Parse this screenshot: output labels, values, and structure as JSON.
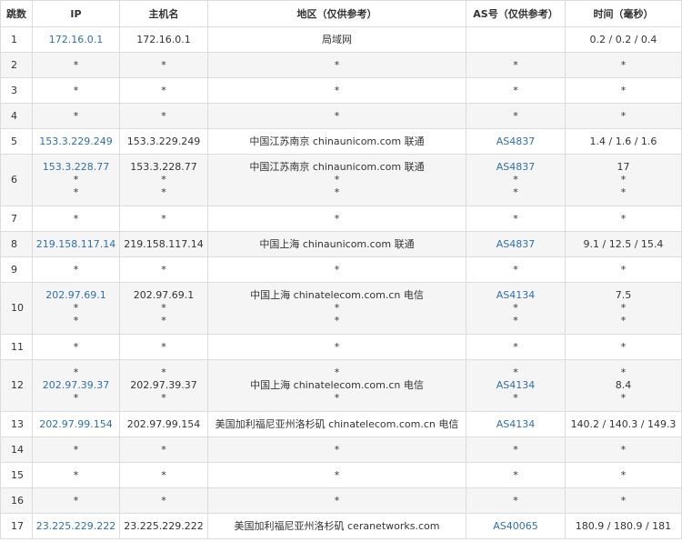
{
  "headers": {
    "hop": "跳数",
    "ip": "IP",
    "host": "主机名",
    "region": "地区（仅供参考）",
    "as": "AS号（仅供参考）",
    "time": "时间（毫秒）"
  },
  "rows": [
    {
      "hop": "1",
      "ip": [
        "172.16.0.1"
      ],
      "host": [
        "172.16.0.1"
      ],
      "region": [
        "局域网"
      ],
      "as": [
        ""
      ],
      "time": [
        "0.2 / 0.2 / 0.4"
      ]
    },
    {
      "hop": "2",
      "ip": [
        "*"
      ],
      "host": [
        "*"
      ],
      "region": [
        "*"
      ],
      "as": [
        "*"
      ],
      "time": [
        "*"
      ]
    },
    {
      "hop": "3",
      "ip": [
        "*"
      ],
      "host": [
        "*"
      ],
      "region": [
        "*"
      ],
      "as": [
        "*"
      ],
      "time": [
        "*"
      ]
    },
    {
      "hop": "4",
      "ip": [
        "*"
      ],
      "host": [
        "*"
      ],
      "region": [
        "*"
      ],
      "as": [
        "*"
      ],
      "time": [
        "*"
      ]
    },
    {
      "hop": "5",
      "ip": [
        "153.3.229.249"
      ],
      "host": [
        "153.3.229.249"
      ],
      "region": [
        "中国江苏南京 chinaunicom.com 联通"
      ],
      "as": [
        "AS4837"
      ],
      "time": [
        "1.4 / 1.6 / 1.6"
      ]
    },
    {
      "hop": "6",
      "ip": [
        "153.3.228.77",
        "*",
        "*"
      ],
      "host": [
        "153.3.228.77",
        "*",
        "*"
      ],
      "region": [
        "中国江苏南京 chinaunicom.com 联通",
        "*",
        "*"
      ],
      "as": [
        "AS4837",
        "*",
        "*"
      ],
      "time": [
        "17",
        "*",
        "*"
      ]
    },
    {
      "hop": "7",
      "ip": [
        "*"
      ],
      "host": [
        "*"
      ],
      "region": [
        "*"
      ],
      "as": [
        "*"
      ],
      "time": [
        "*"
      ]
    },
    {
      "hop": "8",
      "ip": [
        "219.158.117.14"
      ],
      "host": [
        "219.158.117.14"
      ],
      "region": [
        "中国上海 chinaunicom.com 联通"
      ],
      "as": [
        "AS4837"
      ],
      "time": [
        "9.1 / 12.5 / 15.4"
      ]
    },
    {
      "hop": "9",
      "ip": [
        "*"
      ],
      "host": [
        "*"
      ],
      "region": [
        "*"
      ],
      "as": [
        "*"
      ],
      "time": [
        "*"
      ]
    },
    {
      "hop": "10",
      "ip": [
        "202.97.69.1",
        "*",
        "*"
      ],
      "host": [
        "202.97.69.1",
        "*",
        "*"
      ],
      "region": [
        "中国上海 chinatelecom.com.cn 电信",
        "*",
        "*"
      ],
      "as": [
        "AS4134",
        "*",
        "*"
      ],
      "time": [
        "7.5",
        "*",
        "*"
      ]
    },
    {
      "hop": "11",
      "ip": [
        "*"
      ],
      "host": [
        "*"
      ],
      "region": [
        "*"
      ],
      "as": [
        "*"
      ],
      "time": [
        "*"
      ]
    },
    {
      "hop": "12",
      "ip": [
        "*",
        "202.97.39.37",
        "*"
      ],
      "host": [
        "*",
        "202.97.39.37",
        "*"
      ],
      "region": [
        "*",
        "中国上海 chinatelecom.com.cn 电信",
        "*"
      ],
      "as": [
        "*",
        "AS4134",
        "*"
      ],
      "time": [
        "*",
        "8.4",
        "*"
      ]
    },
    {
      "hop": "13",
      "ip": [
        "202.97.99.154"
      ],
      "host": [
        "202.97.99.154"
      ],
      "region": [
        "美国加利福尼亚州洛杉矶 chinatelecom.com.cn 电信"
      ],
      "as": [
        "AS4134"
      ],
      "time": [
        "140.2 / 140.3 / 149.3"
      ]
    },
    {
      "hop": "14",
      "ip": [
        "*"
      ],
      "host": [
        "*"
      ],
      "region": [
        "*"
      ],
      "as": [
        "*"
      ],
      "time": [
        "*"
      ]
    },
    {
      "hop": "15",
      "ip": [
        "*"
      ],
      "host": [
        "*"
      ],
      "region": [
        "*"
      ],
      "as": [
        "*"
      ],
      "time": [
        "*"
      ]
    },
    {
      "hop": "16",
      "ip": [
        "*"
      ],
      "host": [
        "*"
      ],
      "region": [
        "*"
      ],
      "as": [
        "*"
      ],
      "time": [
        "*"
      ]
    },
    {
      "hop": "17",
      "ip": [
        "23.225.229.222"
      ],
      "host": [
        "23.225.229.222"
      ],
      "region": [
        "美国加利福尼亚州洛杉矶 ceranetworks.com"
      ],
      "as": [
        "AS40065"
      ],
      "time": [
        "180.9 / 180.9 / 181"
      ]
    }
  ]
}
